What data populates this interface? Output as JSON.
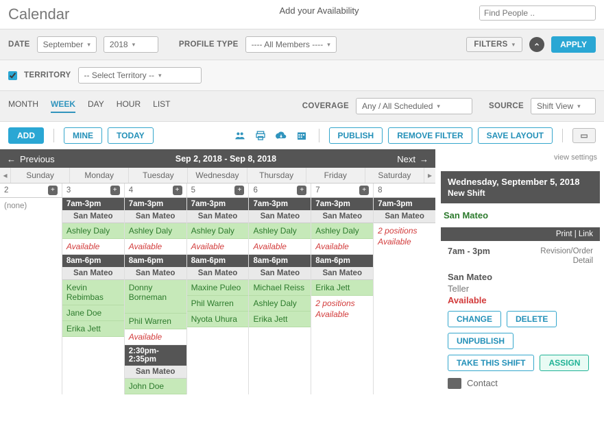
{
  "header": {
    "title": "Calendar",
    "center_text": "Add your Availability",
    "search_placeholder": "Find People .."
  },
  "filters": {
    "date_label": "DATE",
    "month": "September",
    "year": "2018",
    "profile_type_label": "PROFILE TYPE",
    "profile_type_value": "---- All Members ----",
    "filters_label": "FILTERS",
    "apply_label": "APPLY",
    "territory_checked": true,
    "territory_label": "TERRITORY",
    "territory_value": "-- Select Territory --"
  },
  "views": {
    "tabs": [
      "MONTH",
      "WEEK",
      "DAY",
      "HOUR",
      "LIST"
    ],
    "active": "WEEK",
    "coverage_label": "COVERAGE",
    "coverage_value": "Any / All Scheduled",
    "source_label": "SOURCE",
    "source_value": "Shift View"
  },
  "tools": {
    "add": "ADD",
    "mine": "MINE",
    "today": "TODAY",
    "publish": "PUBLISH",
    "remove_filter": "REMOVE FILTER",
    "save_layout": "SAVE LAYOUT"
  },
  "nav": {
    "prev": "Previous",
    "next": "Next",
    "range": "Sep 2, 2018 - Sep 8, 2018"
  },
  "days": {
    "names": [
      "Sunday",
      "Monday",
      "Tuesday",
      "Wednesday",
      "Thursday",
      "Friday",
      "Saturday"
    ],
    "numbers": [
      "2",
      "3",
      "4",
      "5",
      "6",
      "7",
      "8"
    ]
  },
  "none_label": "(none)",
  "block1": {
    "time": "7am-3pm",
    "location": "San Mateo",
    "people": {
      "mon": [
        "Ashley Daly"
      ],
      "tue": [
        "Ashley Daly"
      ],
      "wed": [
        "Ashley Daly"
      ],
      "thu": [
        "Ashley Daly"
      ],
      "fri": [
        "Ashley Daly"
      ]
    },
    "available_label": "Available",
    "sat_lines": [
      "2 positions",
      "Available"
    ]
  },
  "block2": {
    "time": "8am-6pm",
    "location": "San Mateo",
    "people": {
      "mon": [
        "Kevin Rebimbas",
        "Jane Doe",
        "Erika Jett"
      ],
      "tue": [
        "Donny Borneman",
        "Phil Warren"
      ],
      "wed": [
        "Maxine Puleo",
        "Phil Warren",
        "Nyota Uhura"
      ],
      "thu": [
        "Michael Reiss",
        "Ashley Daly",
        "Erika Jett"
      ],
      "fri": [
        "Erika Jett"
      ]
    },
    "tue_available": "Available",
    "fri_lines": [
      "2 positions",
      "Available"
    ]
  },
  "block3": {
    "time": "2:30pm-2:35pm",
    "location": "San Mateo",
    "people": {
      "tue": [
        "John Doe"
      ]
    }
  },
  "detail": {
    "view_settings": "view settings",
    "date": "Wednesday, September 5, 2018",
    "new_shift": "New Shift",
    "location_link": "San Mateo",
    "print": "Print",
    "link": "Link",
    "time": "7am - 3pm",
    "rev1": "Revision/Order",
    "rev2": "Detail",
    "loc": "San Mateo",
    "role": "Teller",
    "available": "Available",
    "buttons": {
      "change": "CHANGE",
      "delete": "DELETE",
      "unpublish": "UNPUBLISH",
      "take": "TAKE THIS SHIFT",
      "assign": "ASSIGN"
    },
    "contact": "Contact"
  }
}
